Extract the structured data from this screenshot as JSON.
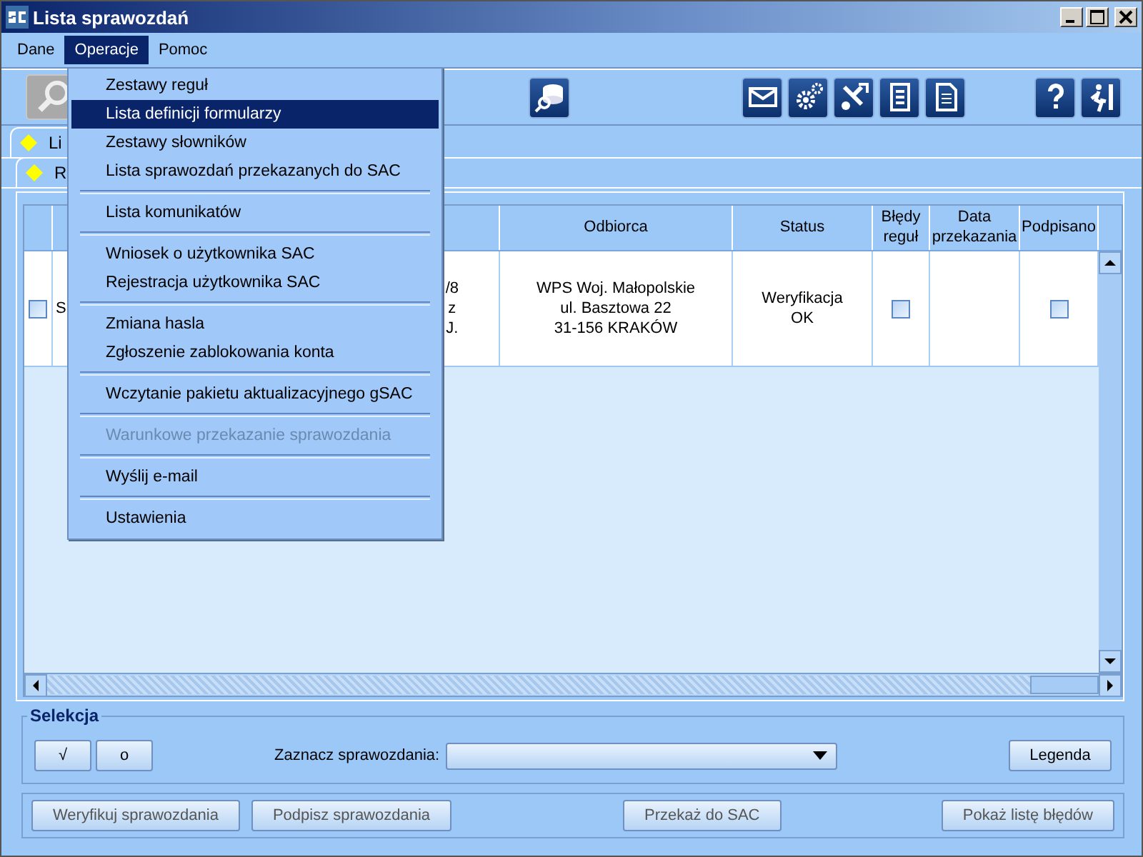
{
  "window": {
    "title": "Lista sprawozdań"
  },
  "menubar": [
    {
      "label": "Dane",
      "selected": false
    },
    {
      "label": "Operacje",
      "selected": true
    },
    {
      "label": "Pomoc",
      "selected": false
    }
  ],
  "menu": {
    "items": [
      {
        "kind": "item",
        "label": "Zestawy reguł",
        "selected": false,
        "disabled": false
      },
      {
        "kind": "item",
        "label": "Lista definicji formularzy",
        "selected": true,
        "disabled": false
      },
      {
        "kind": "item",
        "label": "Zestawy słowników",
        "selected": false,
        "disabled": false
      },
      {
        "kind": "item",
        "label": "Lista sprawozdań przekazanych do SAC",
        "selected": false,
        "disabled": false
      },
      {
        "kind": "separator"
      },
      {
        "kind": "item",
        "label": "Lista komunikatów",
        "selected": false,
        "disabled": false
      },
      {
        "kind": "separator"
      },
      {
        "kind": "item",
        "label": "Wniosek o użytkownika SAC",
        "selected": false,
        "disabled": false
      },
      {
        "kind": "item",
        "label": "Rejestracja użytkownika SAC",
        "selected": false,
        "disabled": false
      },
      {
        "kind": "separator"
      },
      {
        "kind": "item",
        "label": "Zmiana hasla",
        "selected": false,
        "disabled": false
      },
      {
        "kind": "item",
        "label": "Zgłoszenie zablokowania konta",
        "selected": false,
        "disabled": false
      },
      {
        "kind": "separator"
      },
      {
        "kind": "item",
        "label": "Wczytanie pakietu aktualizacyjnego gSAC",
        "selected": false,
        "disabled": false
      },
      {
        "kind": "separator"
      },
      {
        "kind": "item",
        "label": "Warunkowe przekazanie sprawozdania",
        "selected": false,
        "disabled": true
      },
      {
        "kind": "separator"
      },
      {
        "kind": "item",
        "label": "Wyślij e-mail",
        "selected": false,
        "disabled": false
      },
      {
        "kind": "separator"
      },
      {
        "kind": "item",
        "label": "Ustawienia",
        "selected": false,
        "disabled": false
      }
    ]
  },
  "tabs": [
    {
      "label": "Li"
    },
    {
      "label": "R"
    }
  ],
  "table": {
    "columns": [
      "Odbiorca",
      "Status",
      "Błędy reguł",
      "Data przekazania",
      "Podpisano"
    ],
    "rows": [
      {
        "checked": false,
        "column_2": "S",
        "column_3": [
          "/8",
          "z",
          "J."
        ],
        "odbiorca": [
          "WPS Woj. Małopolskie",
          "ul. Basztowa 22",
          "31-156 KRAKÓW"
        ],
        "status": [
          "Weryfikacja",
          "OK"
        ],
        "bledy_regul": false,
        "podpisano": false
      }
    ]
  },
  "selection": {
    "title": "Selekcja",
    "check_all": "√",
    "uncheck_all": "o",
    "filter_label": "Zaznacz sprawozdania:",
    "legend_button": "Legenda"
  },
  "actions": [
    {
      "label": "Weryfikuj sprawozdania",
      "disabled": true
    },
    {
      "label": "Podpisz sprawozdania",
      "disabled": true
    },
    {
      "label": "Przekaż do SAC",
      "disabled": true
    },
    {
      "label": "Pokaż listę błędów",
      "disabled": true
    }
  ]
}
